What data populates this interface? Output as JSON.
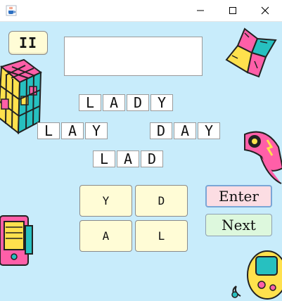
{
  "window": {
    "icon": "java-cup-icon",
    "controls": [
      "minimize-icon",
      "maximize-icon",
      "close-icon"
    ]
  },
  "toolbar": {
    "pause_label": "II"
  },
  "word_display": {
    "value": ""
  },
  "found_words": [
    {
      "letters": [
        "L",
        "A",
        "D",
        "Y"
      ]
    },
    {
      "letters": [
        "L",
        "A",
        "Y"
      ]
    },
    {
      "letters": [
        "D",
        "A",
        "Y"
      ]
    },
    {
      "letters": [
        "L",
        "A",
        "D"
      ]
    }
  ],
  "letter_buttons": [
    "Y",
    "D",
    "A",
    "L"
  ],
  "actions": {
    "enter_label": "Enter",
    "next_label": "Next"
  },
  "decorations": [
    "rubiks-cube-icon",
    "paper-fortune-teller-icon",
    "cassette-tape-icon",
    "skateboard-sticker-icon",
    "handheld-console-icon"
  ],
  "colors": {
    "background": "#c8ecfb",
    "button_fill": "#fffcd6",
    "enter_fill": "#fcdde3",
    "next_fill": "#ddf8dd"
  }
}
